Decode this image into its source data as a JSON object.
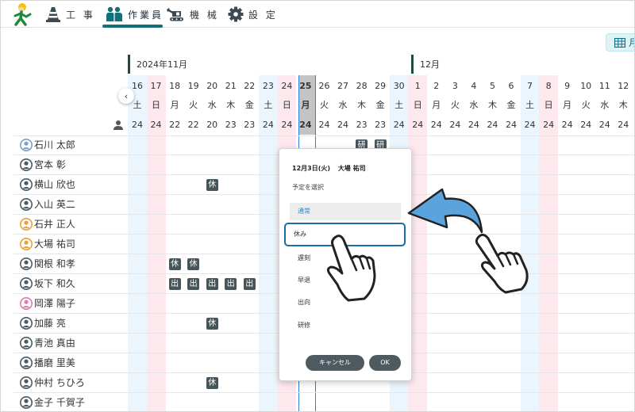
{
  "nav": {
    "items": [
      {
        "label": "工 事",
        "icon": "cone-icon"
      },
      {
        "label": "作業員",
        "icon": "workers-icon"
      },
      {
        "label": "機 械",
        "icon": "excavator-icon"
      },
      {
        "label": "設 定",
        "icon": "gear-icon"
      }
    ],
    "active": "作業員",
    "accent": "#136f78"
  },
  "view_toggle": {
    "label": "月",
    "icon": "calendar-grid-icon"
  },
  "calendar": {
    "months": [
      "2024年11月",
      "12月"
    ],
    "prev_arrow": "‹",
    "days": [
      {
        "d": "16",
        "w": "土",
        "c": "24"
      },
      {
        "d": "17",
        "w": "日",
        "c": "24"
      },
      {
        "d": "18",
        "w": "月",
        "c": "22"
      },
      {
        "d": "19",
        "w": "火",
        "c": "22"
      },
      {
        "d": "20",
        "w": "水",
        "c": "20"
      },
      {
        "d": "21",
        "w": "木",
        "c": "23"
      },
      {
        "d": "22",
        "w": "金",
        "c": "23"
      },
      {
        "d": "23",
        "w": "土",
        "c": "24"
      },
      {
        "d": "24",
        "w": "日",
        "c": "24"
      },
      {
        "d": "25",
        "w": "月",
        "c": "24"
      },
      {
        "d": "26",
        "w": "火",
        "c": "24"
      },
      {
        "d": "27",
        "w": "水",
        "c": "24"
      },
      {
        "d": "28",
        "w": "木",
        "c": "23"
      },
      {
        "d": "29",
        "w": "金",
        "c": "23"
      },
      {
        "d": "30",
        "w": "土",
        "c": "24"
      },
      {
        "d": "1",
        "w": "日",
        "c": "24"
      },
      {
        "d": "2",
        "w": "月",
        "c": "24"
      },
      {
        "d": "3",
        "w": "火",
        "c": "24"
      },
      {
        "d": "4",
        "w": "水",
        "c": "24"
      },
      {
        "d": "5",
        "w": "木",
        "c": "24"
      },
      {
        "d": "6",
        "w": "金",
        "c": "24"
      },
      {
        "d": "7",
        "w": "土",
        "c": "24"
      },
      {
        "d": "8",
        "w": "日",
        "c": "24"
      },
      {
        "d": "9",
        "w": "月",
        "c": "24"
      },
      {
        "d": "10",
        "w": "火",
        "c": "24"
      },
      {
        "d": "11",
        "w": "水",
        "c": "24"
      },
      {
        "d": "12",
        "w": "木",
        "c": "24"
      }
    ],
    "workers": [
      {
        "name": "石川 太郎",
        "avatar": "child"
      },
      {
        "name": "宮本 彰",
        "avatar": "dark"
      },
      {
        "name": "横山 欣也",
        "avatar": "dark"
      },
      {
        "name": "入山 英二",
        "avatar": "dark"
      },
      {
        "name": "石井 正人",
        "avatar": "orange"
      },
      {
        "name": "大場 祐司",
        "avatar": "orange"
      },
      {
        "name": "関根 和孝",
        "avatar": "dark"
      },
      {
        "name": "坂下 和久",
        "avatar": "dark"
      },
      {
        "name": "岡澤 陽子",
        "avatar": "pink"
      },
      {
        "name": "加藤 亮",
        "avatar": "dark"
      },
      {
        "name": "青池 真由",
        "avatar": "dark"
      },
      {
        "name": "播磨 里美",
        "avatar": "dark"
      },
      {
        "name": "仲村 ちひろ",
        "avatar": "dark"
      },
      {
        "name": "金子 千賀子",
        "avatar": "dark"
      }
    ],
    "badges": [
      {
        "row": 0,
        "col": 12,
        "text": "研"
      },
      {
        "row": 0,
        "col": 13,
        "text": "研"
      },
      {
        "row": 2,
        "col": 4,
        "text": "休"
      },
      {
        "row": 6,
        "col": 2,
        "text": "休"
      },
      {
        "row": 6,
        "col": 3,
        "text": "休"
      },
      {
        "row": 7,
        "col": 2,
        "text": "出"
      },
      {
        "row": 7,
        "col": 3,
        "text": "出"
      },
      {
        "row": 7,
        "col": 4,
        "text": "出"
      },
      {
        "row": 7,
        "col": 5,
        "text": "出"
      },
      {
        "row": 7,
        "col": 6,
        "text": "出"
      },
      {
        "row": 9,
        "col": 4,
        "text": "休"
      },
      {
        "row": 12,
        "col": 4,
        "text": "休"
      }
    ]
  },
  "dialog": {
    "date": "12月3日(火)",
    "worker": "大場 祐司",
    "subtitle": "予定を選択",
    "options": [
      "通常",
      "休み",
      "遅刻",
      "早退",
      "出向",
      "研修"
    ],
    "selected": "通常",
    "highlighted": "休み",
    "cancel": "キャンセル",
    "ok": "OK"
  }
}
